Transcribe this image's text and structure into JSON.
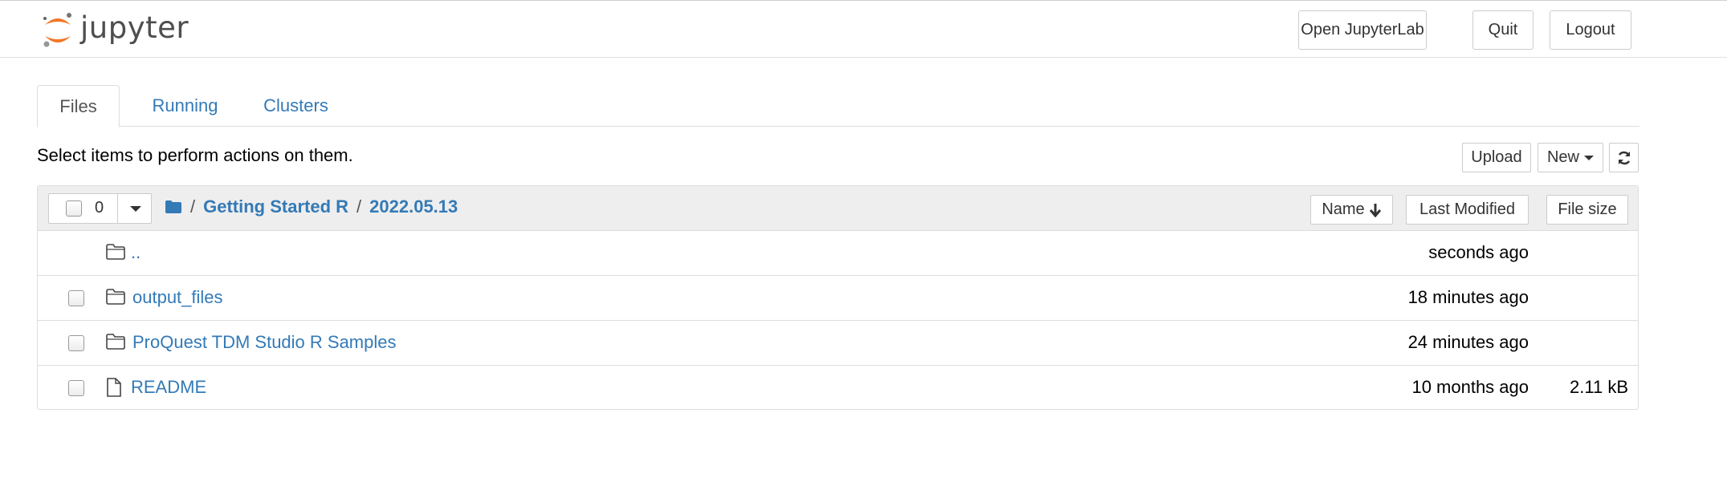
{
  "header": {
    "logo_text": "jupyter",
    "open_jupyterlab_label": "Open JupyterLab",
    "quit_label": "Quit",
    "logout_label": "Logout"
  },
  "tabs": [
    {
      "label": "Files",
      "active": true
    },
    {
      "label": "Running",
      "active": false
    },
    {
      "label": "Clusters",
      "active": false
    }
  ],
  "toolbar": {
    "instructions": "Select items to perform actions on them.",
    "upload_label": "Upload",
    "new_label": "New",
    "refresh_icon": "refresh-icon"
  },
  "list_header": {
    "selected_count": "0",
    "breadcrumb": {
      "root_sep": "/",
      "items": [
        {
          "label": "Getting Started R",
          "sep": "/"
        },
        {
          "label": "2022.05.13"
        }
      ]
    },
    "sort_name_label": "Name",
    "sort_modified_label": "Last Modified",
    "sort_size_label": "File size"
  },
  "items": [
    {
      "name": "..",
      "type": "folder",
      "modified": "seconds ago",
      "size": ""
    },
    {
      "name": "output_files",
      "type": "folder",
      "modified": "18 minutes ago",
      "size": ""
    },
    {
      "name": "ProQuest TDM Studio R Samples",
      "type": "folder",
      "modified": "24 minutes ago",
      "size": ""
    },
    {
      "name": "README",
      "type": "file",
      "modified": "10 months ago",
      "size": "2.11 kB"
    }
  ],
  "colors": {
    "link": "#337ab7",
    "logo_orange": "#f37726",
    "header_bg": "#eeeeee"
  }
}
